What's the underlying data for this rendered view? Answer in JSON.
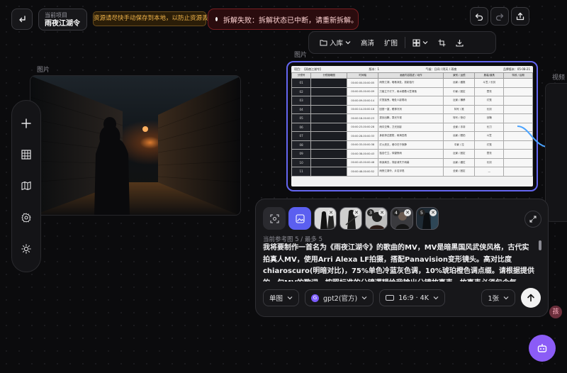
{
  "header": {
    "back_icon": "enter-back-icon",
    "project_label": "当前项目",
    "project_name": "雨夜江湖令",
    "warning": "资源请尽快手动保存到本地，以防止资源丢失",
    "error": "拆解失败：拆解状态已中断，请重新拆解。",
    "error_color": "#e5484d",
    "undo_icon": "undo-icon",
    "redo_icon": "redo-icon",
    "share_icon": "share-upload-icon"
  },
  "toolbar": {
    "store_label": "入库",
    "hd_label": "高清",
    "expand_label": "扩图"
  },
  "nodes": {
    "node1_label": "图片",
    "node2_label": "图片",
    "node3_label": "视频",
    "accent": "#6466f1"
  },
  "storyboard": {
    "head_left": "项目：【雨夜江湖令】",
    "head_mid": "版本：1",
    "head_right": "气候：日间 / 阴天 / 雨夜",
    "head_date": "品牌版本：05-08-21",
    "columns": [
      "分镜号",
      "分镜缩略图",
      "时间轴",
      "画面内容描述 / 动作",
      "景别 / 运镜",
      "服装/道具",
      "特效 / 后期"
    ],
    "rows": [
      {
        "num": "01",
        "time": "00:00:00-00:00:05",
        "desc": "雨夜江湖，暗巷深处，孤影独行",
        "shot": "远景 / 缓推",
        "prop": "斗笠 / 长剑"
      },
      {
        "num": "02",
        "time": "00:00:05-00:00:09",
        "desc": "刀客立于灯下，雨水顺着斗笠滑落",
        "shot": "中景 / 固定",
        "prop": "蓑衣"
      },
      {
        "num": "03",
        "time": "00:00:09-00:00:14",
        "desc": "灯笼摇曳，暗处人影晃动",
        "shot": "近景 / 横移",
        "prop": "灯笼"
      },
      {
        "num": "04",
        "time": "00:00:14-00:00:18",
        "desc": "回首一望，眼神冷冽",
        "shot": "特写 / 推",
        "prop": "长剑"
      },
      {
        "num": "05",
        "time": "00:00:18-00:00:23",
        "desc": "拔剑出鞘，寒光乍现",
        "shot": "特写 / 快切",
        "prop": "剑鞘"
      },
      {
        "num": "06",
        "time": "00:00:23-00:00:28",
        "desc": "雨中交锋，刀光剑影",
        "shot": "全景 / 手持",
        "prop": "长刀"
      },
      {
        "num": "07",
        "time": "00:00:28-00:00:33",
        "desc": "身影掠过屋檐，雨滴四溅",
        "shot": "远景 / 跟拍",
        "prop": "斗笠"
      },
      {
        "num": "08",
        "time": "00:00:33-00:00:38",
        "desc": "灯火熄灭，巷中归于寂静",
        "shot": "中景 / 拉",
        "prop": "灯笼"
      },
      {
        "num": "09",
        "time": "00:00:38-00:00:43",
        "desc": "独自伫立，仰望夜雨",
        "shot": "近景 / 固定",
        "prop": "蓑衣"
      },
      {
        "num": "10",
        "time": "00:00:43-00:00:48",
        "desc": "转身离去，背影消失于雨幕",
        "shot": "远景 / 缓拉",
        "prop": "长剑"
      },
      {
        "num": "11",
        "time": "00:00:48-00:00:52",
        "desc": "雨夜江湖令，片名浮现",
        "shot": "全景 / 固定",
        "prop": "—"
      }
    ]
  },
  "rail": {
    "items": [
      "plus-icon",
      "grid-icon",
      "map-icon",
      "gear-icon",
      "sun-icon"
    ]
  },
  "prompt": {
    "ref_count": "当前参考图 5 / 最多 5",
    "text": "我将要制作一首名为《雨夜江湖令》的歌曲的MV，MV是暗黑国风武侠风格，古代实拍真人MV，使用Arri Alexa LF拍摄，搭配Panavision变形镜头。高对比度chiaroscuro(明暗对比)，75%单色冷蓝灰色调，10%琥珀橙色调点缀。请根据提供的一句MV的歌词，按照标准的分镜逻辑给我输出分镜故事表，故事表必须包含每",
    "mode": "单图",
    "model_badge": "G",
    "model": "gpt2(官方)",
    "ratio": "16:9 · 4K",
    "count": "1张"
  },
  "misc": {
    "avatar_text": "孩",
    "assistant_icon": "robot-icon"
  }
}
